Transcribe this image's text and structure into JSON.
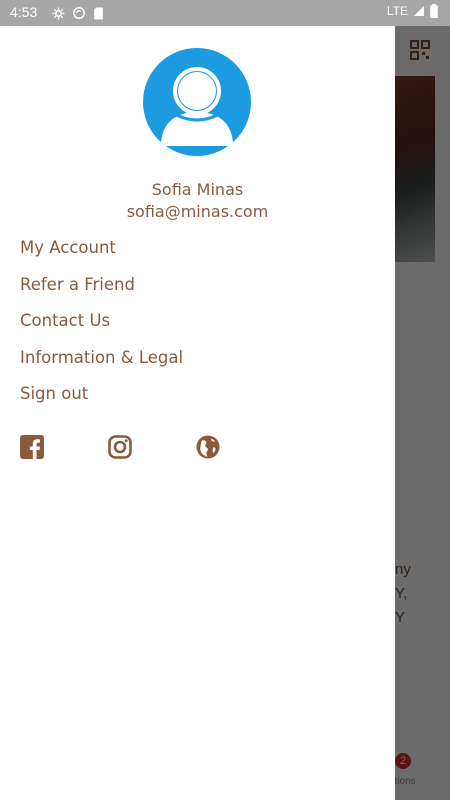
{
  "status_bar": {
    "time": "4:53",
    "network": "LTE"
  },
  "drawer": {
    "user": {
      "name": "Sofia Minas",
      "email": "sofia@minas.com"
    },
    "menu": [
      {
        "label": "My Account"
      },
      {
        "label": "Refer a Friend"
      },
      {
        "label": "Contact Us"
      },
      {
        "label": "Information & Legal"
      },
      {
        "label": "Sign out"
      }
    ],
    "social": [
      {
        "icon": "facebook-icon"
      },
      {
        "icon": "instagram-icon"
      },
      {
        "icon": "globe-icon"
      }
    ]
  },
  "background": {
    "text_lines": [
      "ny",
      "Y,",
      "Y"
    ],
    "badge_count": "2",
    "tab_label": "otions"
  },
  "colors": {
    "accent": "#8b5a3c",
    "avatar_blue": "#1d9be0",
    "status_bar": "#a7a7a7",
    "badge": "#d9322e"
  }
}
